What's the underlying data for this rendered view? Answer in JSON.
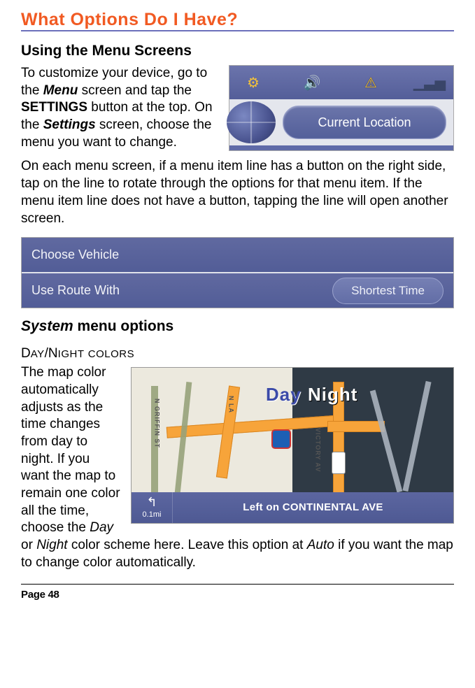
{
  "title": "What Options Do I Have?",
  "section1_heading": "Using the Menu Screens",
  "para1_a": "To customize your device, go to the ",
  "para1_menu": "Menu",
  "para1_b": " screen and tap the ",
  "para1_settingsbtn": "SETTINGS",
  "para1_c": " button at the top. On the ",
  "para1_settings": "Settings",
  "para1_d": " screen, choose the menu you want to change.",
  "para2": "On each menu screen, if a menu item line has a button on the right side, tap on the line to rotate through the options for that menu item. If the menu item line does not have a button, tapping the line will open another screen.",
  "toolbar": {
    "current_location": "Current Location"
  },
  "settings_rows": {
    "row1_label": "Choose Vehicle",
    "row2_label": "Use Route With",
    "row2_value": "Shortest Time"
  },
  "submenu_head_a": "System",
  "submenu_head_b": " menu options",
  "dn_head": {
    "D": "D",
    "ay": "AY",
    "slash": "/",
    "N": "N",
    "ight": "IGHT",
    "sp": " ",
    "c": "COLORS"
  },
  "para3_a": "The map color automatically adjusts as the time changes from day to night. If you want the map to remain one color all the time, choose the ",
  "para3_day": "Day",
  "para3_or": " or ",
  "para3_night": "Night",
  "para3_b": " color scheme here. Leave this option at ",
  "para3_auto": "Auto",
  "para3_c": " if you want the map to change color automatically.",
  "map": {
    "day_label": "Day",
    "night_label": "Night",
    "nav_text": "Left on CONTINENTAL AVE",
    "nav_dist": "0.1mi",
    "street1": "N GRIFFIN ST",
    "street2": "VICTORY AV",
    "street3": "N LA"
  },
  "page_number": "Page 48"
}
